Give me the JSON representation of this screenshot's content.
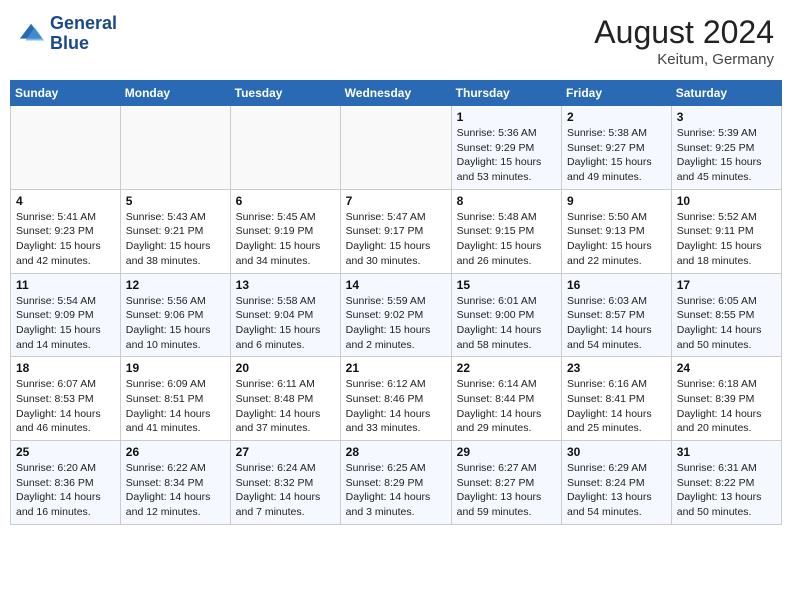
{
  "header": {
    "logo_line1": "General",
    "logo_line2": "Blue",
    "month_year": "August 2024",
    "location": "Keitum, Germany"
  },
  "weekdays": [
    "Sunday",
    "Monday",
    "Tuesday",
    "Wednesday",
    "Thursday",
    "Friday",
    "Saturday"
  ],
  "weeks": [
    [
      {
        "day": "",
        "info": ""
      },
      {
        "day": "",
        "info": ""
      },
      {
        "day": "",
        "info": ""
      },
      {
        "day": "",
        "info": ""
      },
      {
        "day": "1",
        "info": "Sunrise: 5:36 AM\nSunset: 9:29 PM\nDaylight: 15 hours\nand 53 minutes."
      },
      {
        "day": "2",
        "info": "Sunrise: 5:38 AM\nSunset: 9:27 PM\nDaylight: 15 hours\nand 49 minutes."
      },
      {
        "day": "3",
        "info": "Sunrise: 5:39 AM\nSunset: 9:25 PM\nDaylight: 15 hours\nand 45 minutes."
      }
    ],
    [
      {
        "day": "4",
        "info": "Sunrise: 5:41 AM\nSunset: 9:23 PM\nDaylight: 15 hours\nand 42 minutes."
      },
      {
        "day": "5",
        "info": "Sunrise: 5:43 AM\nSunset: 9:21 PM\nDaylight: 15 hours\nand 38 minutes."
      },
      {
        "day": "6",
        "info": "Sunrise: 5:45 AM\nSunset: 9:19 PM\nDaylight: 15 hours\nand 34 minutes."
      },
      {
        "day": "7",
        "info": "Sunrise: 5:47 AM\nSunset: 9:17 PM\nDaylight: 15 hours\nand 30 minutes."
      },
      {
        "day": "8",
        "info": "Sunrise: 5:48 AM\nSunset: 9:15 PM\nDaylight: 15 hours\nand 26 minutes."
      },
      {
        "day": "9",
        "info": "Sunrise: 5:50 AM\nSunset: 9:13 PM\nDaylight: 15 hours\nand 22 minutes."
      },
      {
        "day": "10",
        "info": "Sunrise: 5:52 AM\nSunset: 9:11 PM\nDaylight: 15 hours\nand 18 minutes."
      }
    ],
    [
      {
        "day": "11",
        "info": "Sunrise: 5:54 AM\nSunset: 9:09 PM\nDaylight: 15 hours\nand 14 minutes."
      },
      {
        "day": "12",
        "info": "Sunrise: 5:56 AM\nSunset: 9:06 PM\nDaylight: 15 hours\nand 10 minutes."
      },
      {
        "day": "13",
        "info": "Sunrise: 5:58 AM\nSunset: 9:04 PM\nDaylight: 15 hours\nand 6 minutes."
      },
      {
        "day": "14",
        "info": "Sunrise: 5:59 AM\nSunset: 9:02 PM\nDaylight: 15 hours\nand 2 minutes."
      },
      {
        "day": "15",
        "info": "Sunrise: 6:01 AM\nSunset: 9:00 PM\nDaylight: 14 hours\nand 58 minutes."
      },
      {
        "day": "16",
        "info": "Sunrise: 6:03 AM\nSunset: 8:57 PM\nDaylight: 14 hours\nand 54 minutes."
      },
      {
        "day": "17",
        "info": "Sunrise: 6:05 AM\nSunset: 8:55 PM\nDaylight: 14 hours\nand 50 minutes."
      }
    ],
    [
      {
        "day": "18",
        "info": "Sunrise: 6:07 AM\nSunset: 8:53 PM\nDaylight: 14 hours\nand 46 minutes."
      },
      {
        "day": "19",
        "info": "Sunrise: 6:09 AM\nSunset: 8:51 PM\nDaylight: 14 hours\nand 41 minutes."
      },
      {
        "day": "20",
        "info": "Sunrise: 6:11 AM\nSunset: 8:48 PM\nDaylight: 14 hours\nand 37 minutes."
      },
      {
        "day": "21",
        "info": "Sunrise: 6:12 AM\nSunset: 8:46 PM\nDaylight: 14 hours\nand 33 minutes."
      },
      {
        "day": "22",
        "info": "Sunrise: 6:14 AM\nSunset: 8:44 PM\nDaylight: 14 hours\nand 29 minutes."
      },
      {
        "day": "23",
        "info": "Sunrise: 6:16 AM\nSunset: 8:41 PM\nDaylight: 14 hours\nand 25 minutes."
      },
      {
        "day": "24",
        "info": "Sunrise: 6:18 AM\nSunset: 8:39 PM\nDaylight: 14 hours\nand 20 minutes."
      }
    ],
    [
      {
        "day": "25",
        "info": "Sunrise: 6:20 AM\nSunset: 8:36 PM\nDaylight: 14 hours\nand 16 minutes."
      },
      {
        "day": "26",
        "info": "Sunrise: 6:22 AM\nSunset: 8:34 PM\nDaylight: 14 hours\nand 12 minutes."
      },
      {
        "day": "27",
        "info": "Sunrise: 6:24 AM\nSunset: 8:32 PM\nDaylight: 14 hours\nand 7 minutes."
      },
      {
        "day": "28",
        "info": "Sunrise: 6:25 AM\nSunset: 8:29 PM\nDaylight: 14 hours\nand 3 minutes."
      },
      {
        "day": "29",
        "info": "Sunrise: 6:27 AM\nSunset: 8:27 PM\nDaylight: 13 hours\nand 59 minutes."
      },
      {
        "day": "30",
        "info": "Sunrise: 6:29 AM\nSunset: 8:24 PM\nDaylight: 13 hours\nand 54 minutes."
      },
      {
        "day": "31",
        "info": "Sunrise: 6:31 AM\nSunset: 8:22 PM\nDaylight: 13 hours\nand 50 minutes."
      }
    ]
  ]
}
